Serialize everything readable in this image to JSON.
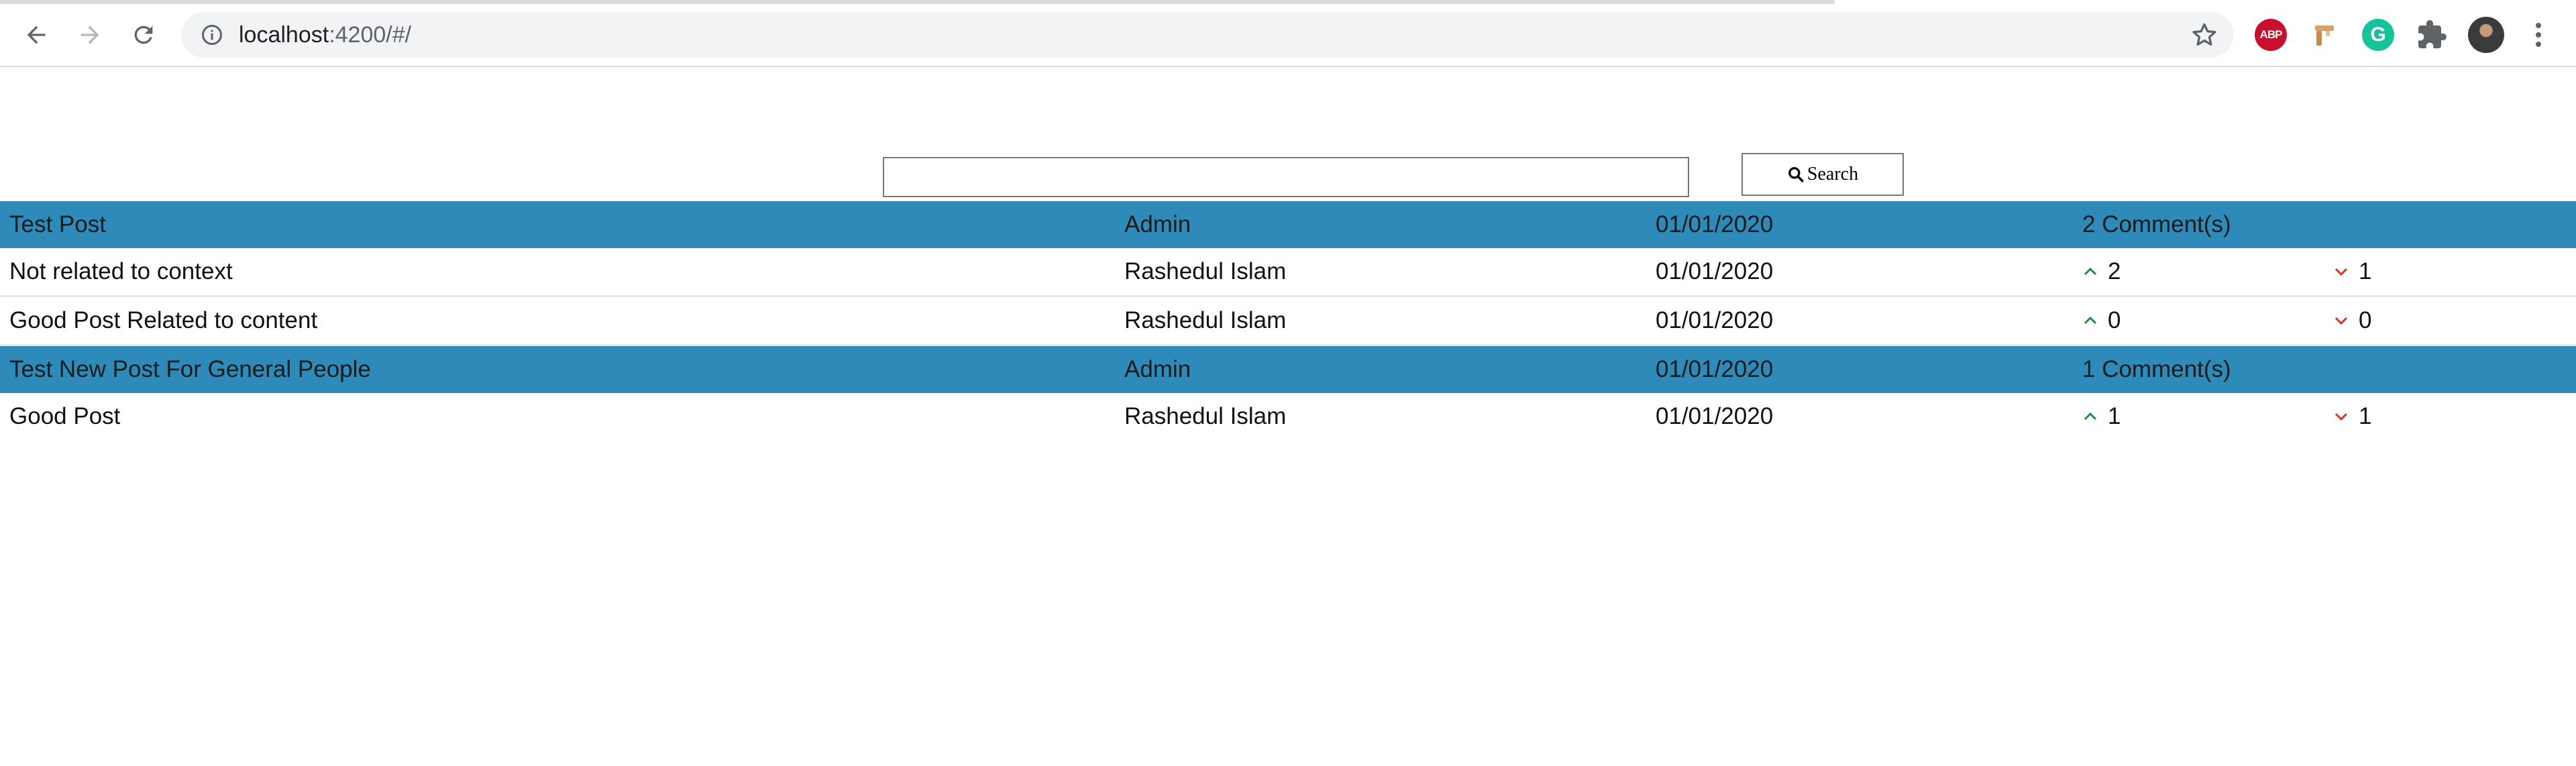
{
  "browser": {
    "url_host": "localhost",
    "url_path": ":4200/#/",
    "extensions": [
      {
        "name": "adblock-plus",
        "label": "ABP"
      },
      {
        "name": "pin-extension",
        "label": ""
      },
      {
        "name": "grammarly",
        "label": "G"
      }
    ]
  },
  "search": {
    "input_value": "",
    "button_label": "Search"
  },
  "posts": [
    {
      "title": "Test Post",
      "author": "Admin",
      "date": "01/01/2020",
      "comment_count": "2 Comment(s)",
      "comments": [
        {
          "text": "Not related to context",
          "author": "Rashedul Islam",
          "date": "01/01/2020",
          "upvotes": "2",
          "downvotes": "1"
        },
        {
          "text": "Good Post Related to content",
          "author": "Rashedul Islam",
          "date": "01/01/2020",
          "upvotes": "0",
          "downvotes": "0"
        }
      ]
    },
    {
      "title": "Test New Post For General People",
      "author": "Admin",
      "date": "01/01/2020",
      "comment_count": "1 Comment(s)",
      "comments": [
        {
          "text": "Good Post",
          "author": "Rashedul Islam",
          "date": "01/01/2020",
          "upvotes": "1",
          "downvotes": "1"
        }
      ]
    }
  ],
  "colors": {
    "post_header_bg": "#2e8bb9",
    "upvote": "#1e8e3e",
    "downvote": "#d93025"
  }
}
